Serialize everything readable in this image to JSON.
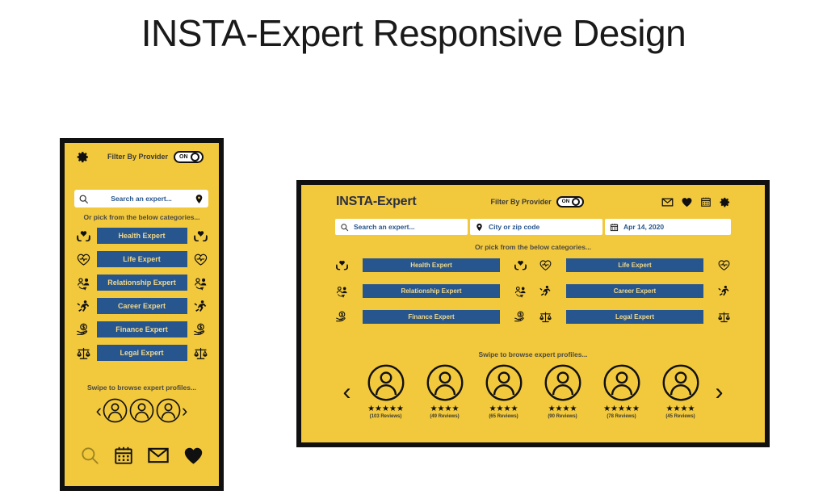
{
  "page": {
    "title": "INSTA-Expert Responsive Design",
    "background_color": "#ffffff",
    "accent_yellow": "#f2c83c",
    "accent_blue": "#27558d",
    "button_text_color": "#f1d98a",
    "border_color": "#101010"
  },
  "mobile": {
    "gear_icon": "gear-icon",
    "filter_label": "Filter By Provider",
    "toggle_state": "ON",
    "search": {
      "placeholder": "Search an expert...",
      "leading_icon": "search-icon",
      "trailing_icon": "location-pin-icon"
    },
    "pick_label": "Or pick from the below categories...",
    "categories": [
      {
        "label": "Health Expert",
        "icon": "hands-heart-icon"
      },
      {
        "label": "Life Expert",
        "icon": "heart-pulse-icon"
      },
      {
        "label": "Relationship Expert",
        "icon": "two-people-icon"
      },
      {
        "label": "Career Expert",
        "icon": "running-person-icon"
      },
      {
        "label": "Finance Expert",
        "icon": "hand-dollar-icon"
      },
      {
        "label": "Legal Expert",
        "icon": "scales-icon"
      }
    ],
    "swipe_label": "Swipe to browse expert profiles...",
    "carousel": {
      "prev_icon": "chevron-left-icon",
      "next_icon": "chevron-right-icon",
      "prev_glyph": "‹",
      "next_glyph": "›",
      "avatar_count": 3
    },
    "bottom_nav": [
      {
        "icon": "search-icon",
        "active": false
      },
      {
        "icon": "calendar-icon",
        "active": true
      },
      {
        "icon": "envelope-icon",
        "active": true
      },
      {
        "icon": "heart-icon",
        "active": true
      }
    ]
  },
  "desktop": {
    "logo": "INSTA-Expert",
    "filter_label": "Filter By Provider",
    "toggle_state": "ON",
    "top_icons": [
      {
        "icon": "envelope-icon"
      },
      {
        "icon": "heart-icon"
      },
      {
        "icon": "calendar-icon"
      },
      {
        "icon": "gear-icon"
      }
    ],
    "search_fields": [
      {
        "icon": "search-icon",
        "value": "Search an expert..."
      },
      {
        "icon": "location-pin-icon",
        "value": "City or zip code"
      },
      {
        "icon": "calendar-icon",
        "value": "Apr 14, 2020"
      }
    ],
    "pick_label": "Or pick from the below categories...",
    "categories": [
      {
        "label": "Health Expert",
        "icon": "hands-heart-icon"
      },
      {
        "label": "Life Expert",
        "icon": "heart-pulse-icon"
      },
      {
        "label": "Relationship Expert",
        "icon": "two-people-icon"
      },
      {
        "label": "Career Expert",
        "icon": "running-person-icon"
      },
      {
        "label": "Finance Expert",
        "icon": "hand-dollar-icon"
      },
      {
        "label": "Legal Expert",
        "icon": "scales-icon"
      }
    ],
    "swipe_label": "Swipe to browse expert profiles...",
    "carousel": {
      "prev_icon": "chevron-left-icon",
      "next_icon": "chevron-right-icon",
      "prev_glyph": "‹",
      "next_glyph": "›"
    },
    "profiles": [
      {
        "stars": "★★★★★",
        "rating": 5,
        "reviews": "(103 Reviews)"
      },
      {
        "stars": "★★★★",
        "rating": 4,
        "reviews": "(49 Reviews)"
      },
      {
        "stars": "★★★★",
        "rating": 4,
        "reviews": "(65 Reviews)"
      },
      {
        "stars": "★★★★",
        "rating": 4,
        "reviews": "(90 Reviews)"
      },
      {
        "stars": "★★★★★",
        "rating": 5,
        "reviews": "(78 Reviews)"
      },
      {
        "stars": "★★★★",
        "rating": 4,
        "reviews": "(45 Reviews)"
      }
    ]
  }
}
